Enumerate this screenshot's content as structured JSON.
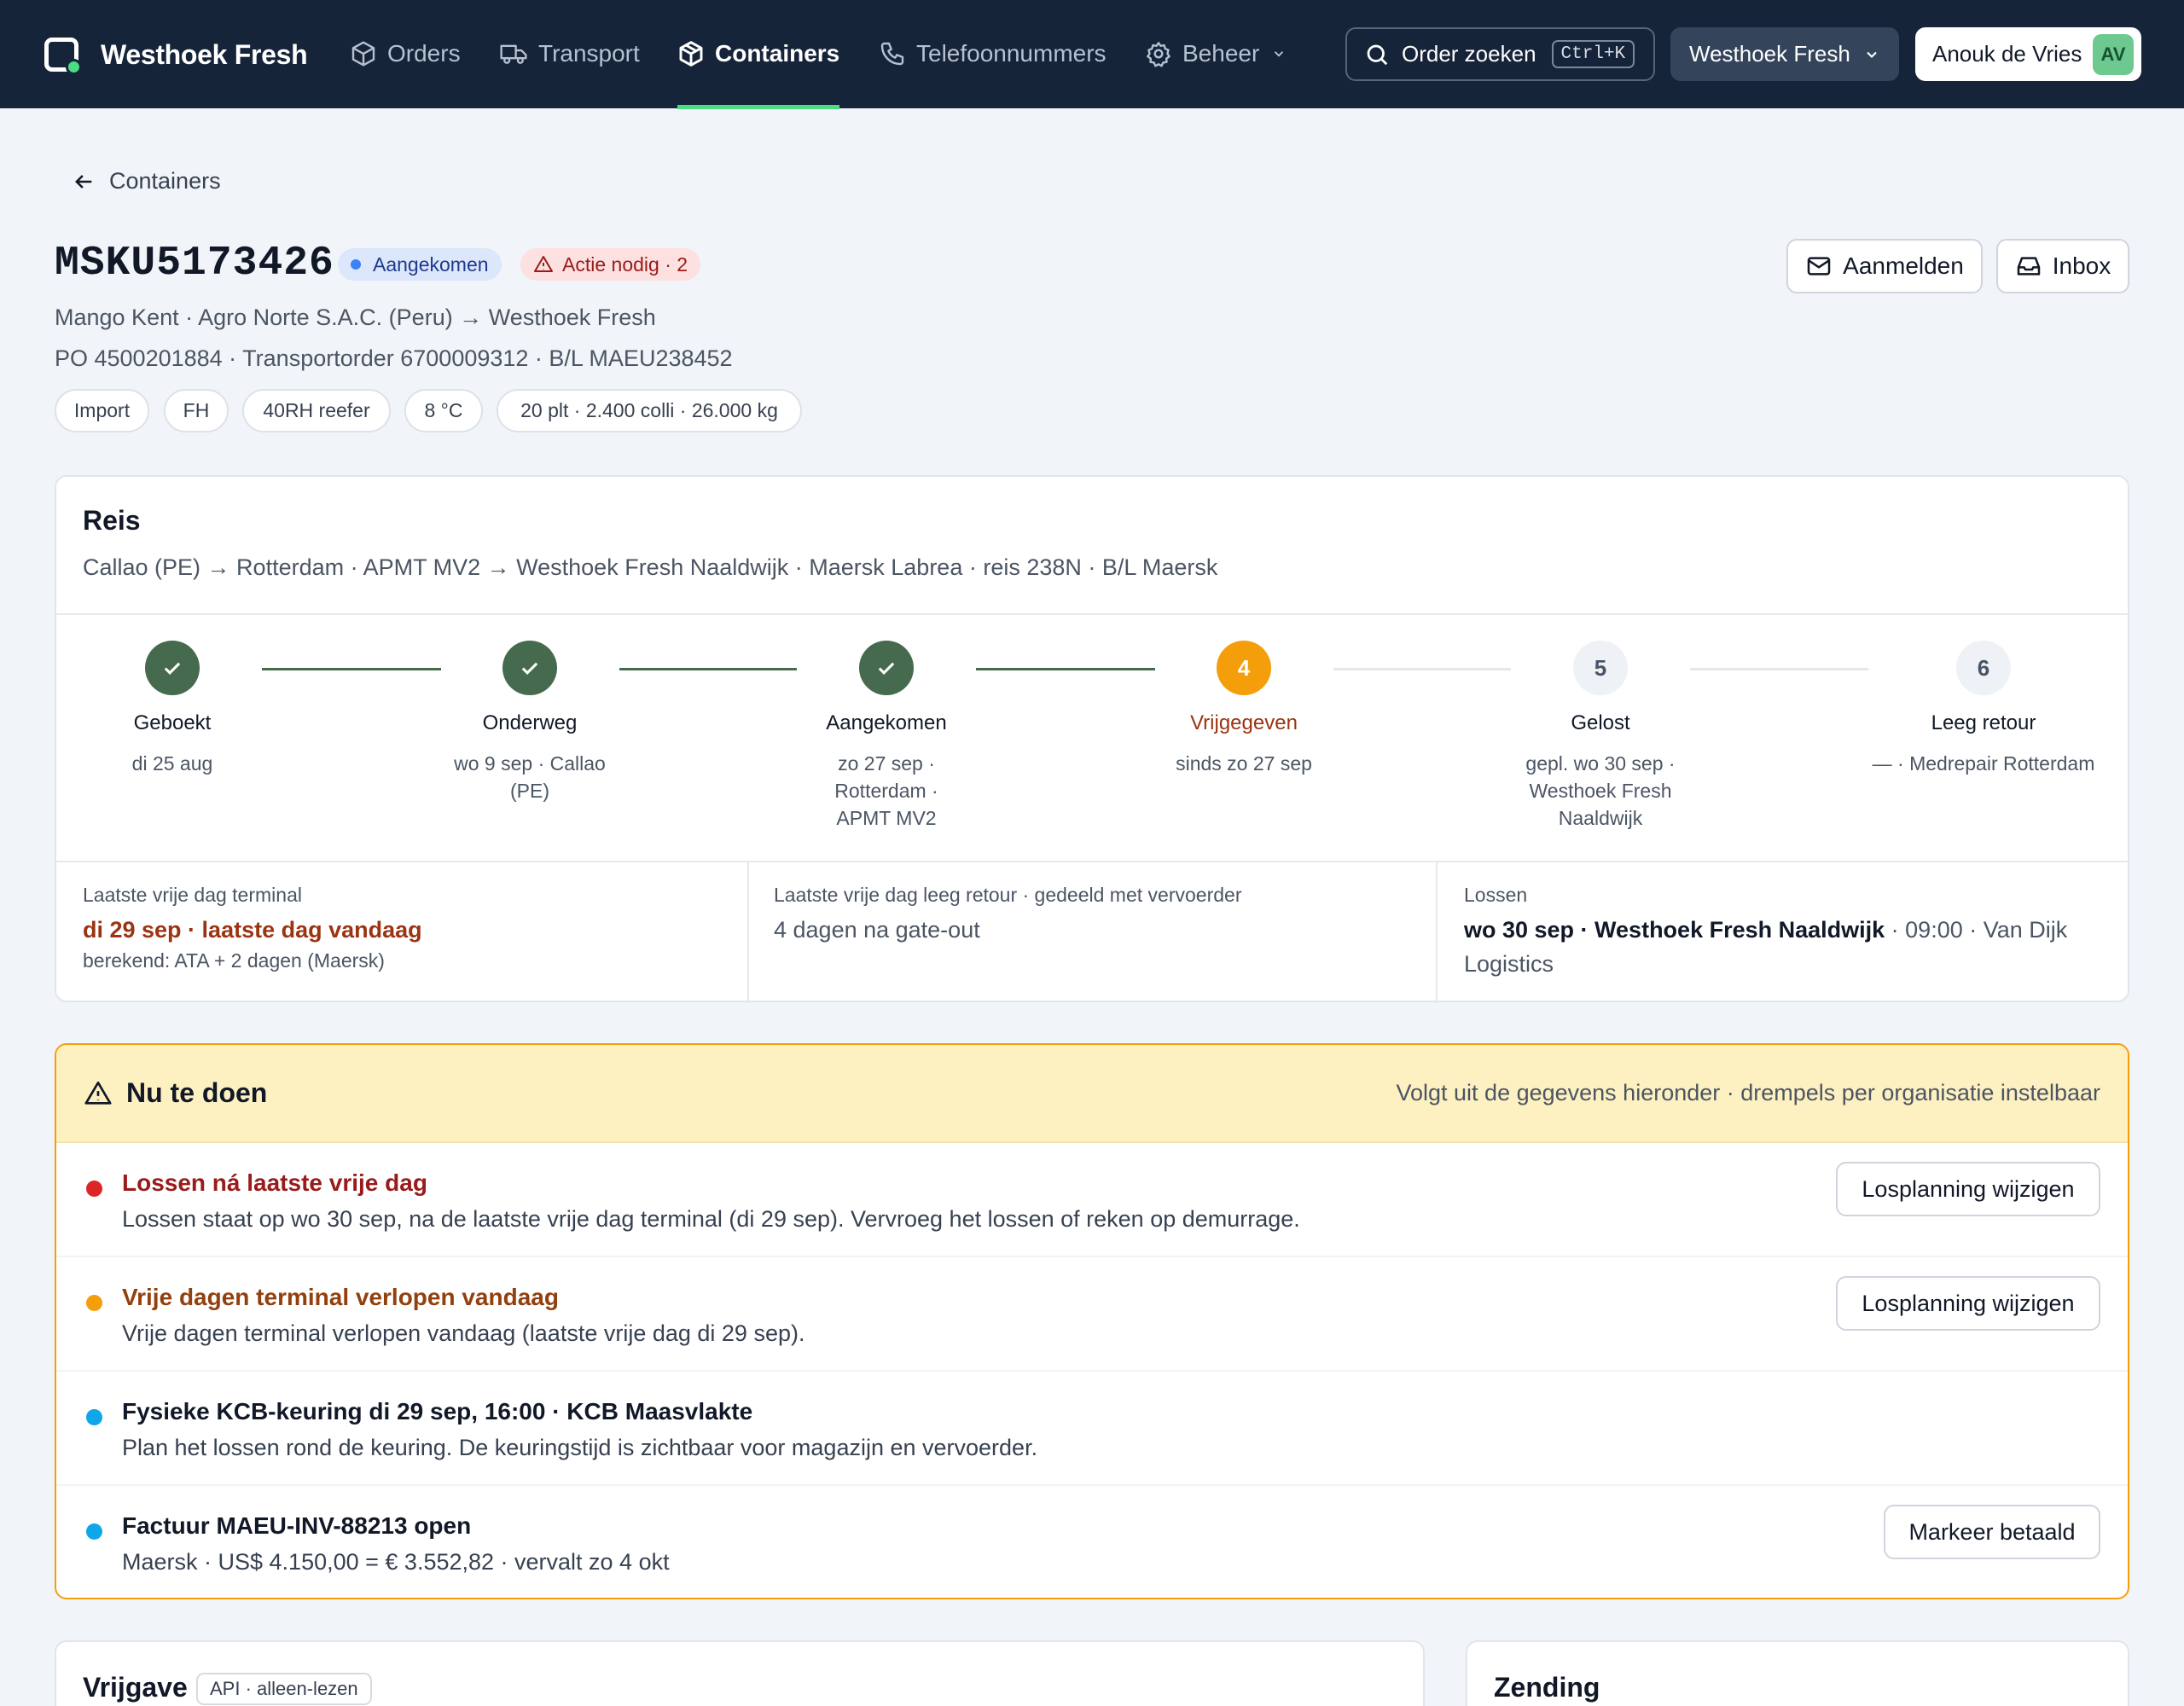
{
  "nav": {
    "brand": "Westhoek Fresh",
    "items": [
      {
        "label": "Orders",
        "icon": "box-icon"
      },
      {
        "label": "Transport",
        "icon": "truck-icon"
      },
      {
        "label": "Containers",
        "icon": "package-icon",
        "active": true
      },
      {
        "label": "Telefoonnummers",
        "icon": "phone-icon"
      },
      {
        "label": "Beheer",
        "icon": "gear-icon"
      }
    ],
    "search_label": "Order zoeken",
    "search_shortcut": "Ctrl+K",
    "org": "Westhoek Fresh",
    "user": "Anouk de Vries",
    "user_initials": "AV"
  },
  "back": "Containers",
  "container": {
    "id": "MSKU5173426",
    "status": "Aangekomen",
    "alert": "Actie nodig · 2",
    "line1": "Mango Kent · Agro Norte S.A.C. (Peru) → Westhoek Fresh",
    "line2": "PO 4500201884 · Transportorder 6700009312 · B/L MAEU238452",
    "chips": [
      "Import",
      "FH",
      "40RH reefer",
      "8 °C",
      "20 plt · 2.400 colli · 26.000 kg"
    ]
  },
  "actions": {
    "register": "Aanmelden",
    "inbox": "Inbox"
  },
  "reis": {
    "title": "Reis",
    "route": "Callao (PE) → Rotterdam · APMT MV2 → Westhoek Fresh Naaldwijk · Maersk Labrea · reis 238N · B/L Maersk",
    "steps": [
      {
        "num": "1",
        "label": "Geboekt",
        "date": "di 25 aug"
      },
      {
        "num": "2",
        "label": "Onderweg",
        "date": "wo 9 sep · Callao (PE)"
      },
      {
        "num": "3",
        "label": "Aangekomen",
        "date": "zo 27 sep · Rotterdam · APMT MV2"
      },
      {
        "num": "4",
        "label": "Vrijgegeven",
        "date": "sinds zo 27 sep"
      },
      {
        "num": "5",
        "label": "Gelost",
        "date": "gepl. wo 30 sep · Westhoek Fresh Naaldwijk"
      },
      {
        "num": "6",
        "label": "Leeg retour",
        "date": "— · Medrepair Rotterdam"
      }
    ],
    "free_terminal": {
      "label": "Laatste vrije dag terminal",
      "value": "di 29 sep · laatste dag vandaag",
      "note": "berekend: ATA + 2 dagen (Maersk)"
    },
    "free_return": {
      "label": "Laatste vrije dag leeg retour · gedeeld met vervoerder",
      "value": "4 dagen na gate-out"
    },
    "unload": {
      "label": "Lossen",
      "value_strong": "wo 30 sep · Westhoek Fresh Naaldwijk",
      "value_rest": " · 09:00 · Van Dijk Logistics"
    }
  },
  "todo": {
    "title": "Nu te doen",
    "subtitle": "Volgt uit de gegevens hieronder · drempels per organisatie instelbaar",
    "items": [
      {
        "title": "Lossen ná laatste vrije dag",
        "text": "Lossen staat op wo 30 sep, na de laatste vrije dag terminal (di 29 sep). Vervroeg het lossen of reken op demurrage.",
        "button": "Losplanning wijzigen",
        "color": "#dc2626",
        "title_color": "#991b1b"
      },
      {
        "title": "Vrije dagen terminal verlopen vandaag",
        "text": "Vrije dagen terminal verlopen vandaag (laatste vrije dag di 29 sep).",
        "button": "Losplanning wijzigen",
        "color": "#f59e0b",
        "title_color": "#92400e"
      },
      {
        "title": "Fysieke KCB-keuring di 29 sep, 16:00 · KCB Maasvlakte",
        "text": "Plan het lossen rond de keuring. De keuringstijd is zichtbaar voor magazijn en vervoerder.",
        "button": "",
        "color": "#0ea5e9",
        "title_color": "#111827"
      },
      {
        "title": "Factuur MAEU-INV-88213 open",
        "text": "Maersk · US$ 4.150,00 = € 3.552,82 · vervalt zo 4 okt",
        "button": "Markeer betaald",
        "color": "#0ea5e9",
        "title_color": "#111827"
      }
    ]
  },
  "vrijgave": {
    "title": "Vrijgave",
    "tag": "API · alleen-lezen"
  },
  "zending": {
    "title": "Zending"
  }
}
